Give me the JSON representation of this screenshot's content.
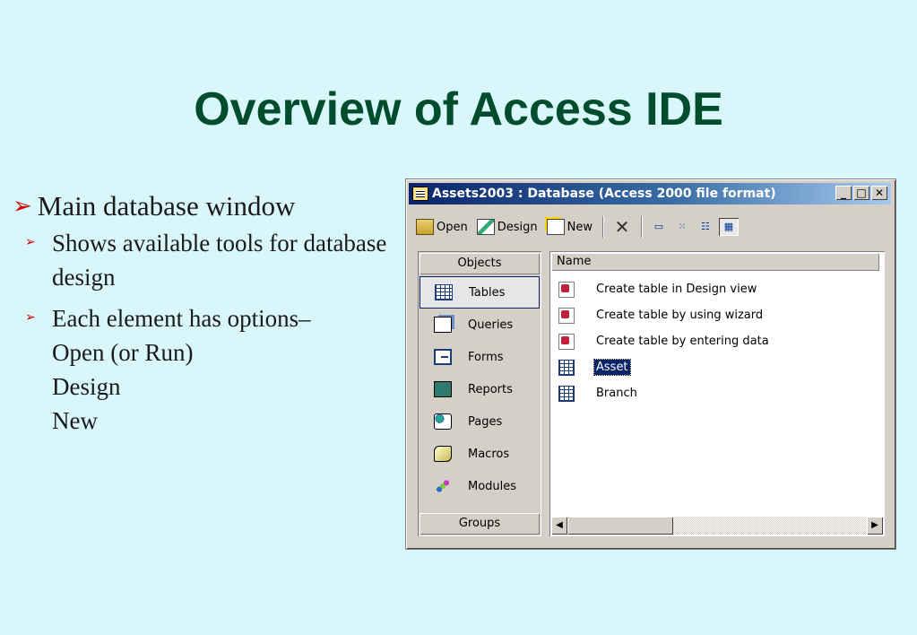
{
  "slide": {
    "title": "Overview of Access IDE",
    "bullet_main": "Main database window",
    "sub_bullets": [
      "Shows available tools for database design",
      "Each element has options–"
    ],
    "options_lines": [
      "Open (or Run)",
      "Design",
      "New"
    ]
  },
  "window": {
    "title": "Assets2003 : Database (Access 2000 file format)",
    "controls": {
      "minimize": "_",
      "maximize": "□",
      "close": "✕"
    },
    "toolbar": {
      "open_label": "Open",
      "design_label": "Design",
      "new_label": "New"
    },
    "objects": {
      "header": "Objects",
      "items": [
        "Tables",
        "Queries",
        "Forms",
        "Reports",
        "Pages",
        "Macros",
        "Modules"
      ],
      "selected": "Tables",
      "footer": "Groups"
    },
    "list": {
      "column_header": "Name",
      "rows": [
        "Create table in Design view",
        "Create table by using wizard",
        "Create table by entering data",
        "Asset",
        "Branch"
      ],
      "selected": "Asset"
    }
  },
  "colors": {
    "background": "#d9f7fa",
    "title": "#004d2e",
    "bullet_marker": "#cc0000",
    "titlebar_start": "#0a246a",
    "selection": "#0a246a"
  }
}
